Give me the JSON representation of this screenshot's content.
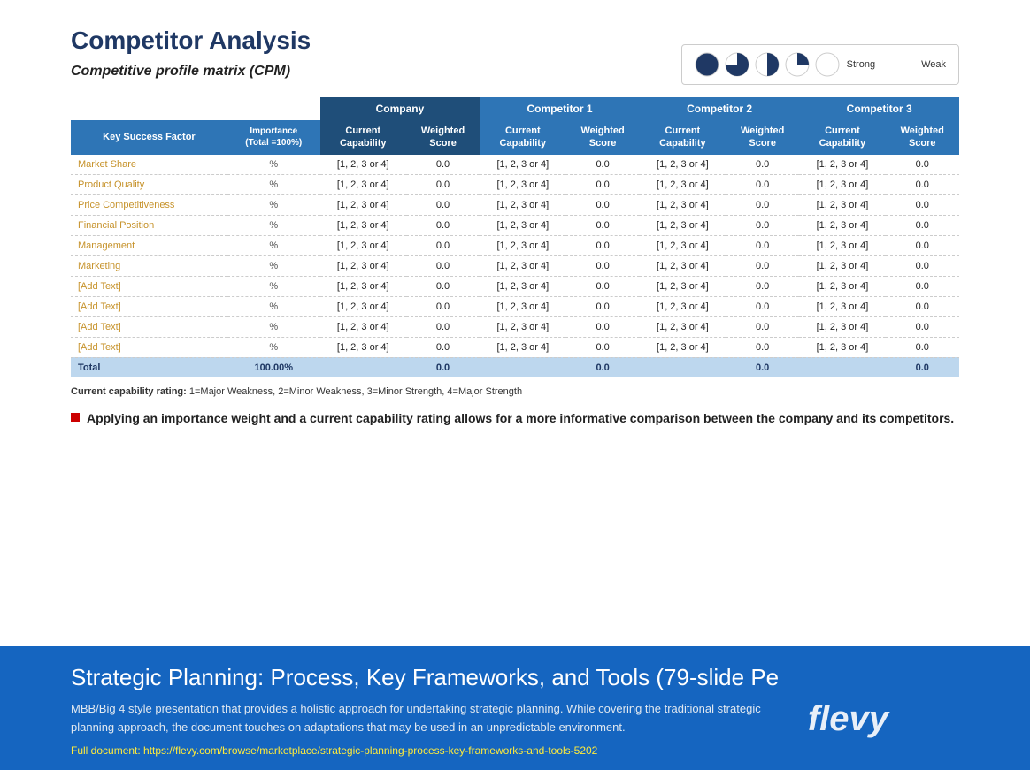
{
  "header": {
    "title": "Competitor Analysis",
    "subtitle": "Competitive profile matrix (CPM)"
  },
  "legend": {
    "label_strong": "Strong",
    "label_weak": "Weak",
    "circles": [
      {
        "fill": "#1f3864",
        "label": "full"
      },
      {
        "fill": "#1f3864",
        "label": "three-quarter",
        "half": true
      },
      {
        "fill": "#1f3864",
        "label": "half"
      },
      {
        "fill": "#1f3864",
        "label": "quarter"
      },
      {
        "fill": "#fff",
        "label": "empty"
      }
    ]
  },
  "table": {
    "groups": {
      "company": "Company",
      "comp1": "Competitor 1",
      "comp2": "Competitor 2",
      "comp3": "Competitor 3"
    },
    "col_headers": {
      "ksf": "Key Success Factor",
      "importance": "Importance (Total =100%)",
      "current_cap": "Current Capability",
      "weighted_score": "Weighted Score"
    },
    "rows": [
      {
        "factor": "Market Share",
        "importance": "%",
        "cap_co": "[1, 2, 3 or 4]",
        "ws_co": "0.0",
        "cap_c1": "[1, 2, 3 or 4]",
        "ws_c1": "0.0",
        "cap_c2": "[1, 2, 3 or 4]",
        "ws_c2": "0.0",
        "cap_c3": "[1, 2, 3 or 4]",
        "ws_c3": "0.0"
      },
      {
        "factor": "Product Quality",
        "importance": "%",
        "cap_co": "[1, 2, 3 or 4]",
        "ws_co": "0.0",
        "cap_c1": "[1, 2, 3 or 4]",
        "ws_c1": "0.0",
        "cap_c2": "[1, 2, 3 or 4]",
        "ws_c2": "0.0",
        "cap_c3": "[1, 2, 3 or 4]",
        "ws_c3": "0.0"
      },
      {
        "factor": "Price Competitiveness",
        "importance": "%",
        "cap_co": "[1, 2, 3 or 4]",
        "ws_co": "0.0",
        "cap_c1": "[1, 2, 3 or 4]",
        "ws_c1": "0.0",
        "cap_c2": "[1, 2, 3 or 4]",
        "ws_c2": "0.0",
        "cap_c3": "[1, 2, 3 or 4]",
        "ws_c3": "0.0"
      },
      {
        "factor": "Financial Position",
        "importance": "%",
        "cap_co": "[1, 2, 3 or 4]",
        "ws_co": "0.0",
        "cap_c1": "[1, 2, 3 or 4]",
        "ws_c1": "0.0",
        "cap_c2": "[1, 2, 3 or 4]",
        "ws_c2": "0.0",
        "cap_c3": "[1, 2, 3 or 4]",
        "ws_c3": "0.0"
      },
      {
        "factor": "Management",
        "importance": "%",
        "cap_co": "[1, 2, 3 or 4]",
        "ws_co": "0.0",
        "cap_c1": "[1, 2, 3 or 4]",
        "ws_c1": "0.0",
        "cap_c2": "[1, 2, 3 or 4]",
        "ws_c2": "0.0",
        "cap_c3": "[1, 2, 3 or 4]",
        "ws_c3": "0.0"
      },
      {
        "factor": "Marketing",
        "importance": "%",
        "cap_co": "[1, 2, 3 or 4]",
        "ws_co": "0.0",
        "cap_c1": "[1, 2, 3 or 4]",
        "ws_c1": "0.0",
        "cap_c2": "[1, 2, 3 or 4]",
        "ws_c2": "0.0",
        "cap_c3": "[1, 2, 3 or 4]",
        "ws_c3": "0.0"
      },
      {
        "factor": "[Add Text]",
        "importance": "%",
        "cap_co": "[1, 2, 3 or 4]",
        "ws_co": "0.0",
        "cap_c1": "[1, 2, 3 or 4]",
        "ws_c1": "0.0",
        "cap_c2": "[1, 2, 3 or 4]",
        "ws_c2": "0.0",
        "cap_c3": "[1, 2, 3 or 4]",
        "ws_c3": "0.0"
      },
      {
        "factor": "[Add Text]",
        "importance": "%",
        "cap_co": "[1, 2, 3 or 4]",
        "ws_co": "0.0",
        "cap_c1": "[1, 2, 3 or 4]",
        "ws_c1": "0.0",
        "cap_c2": "[1, 2, 3 or 4]",
        "ws_c2": "0.0",
        "cap_c3": "[1, 2, 3 or 4]",
        "ws_c3": "0.0"
      },
      {
        "factor": "[Add Text]",
        "importance": "%",
        "cap_co": "[1, 2, 3 or 4]",
        "ws_co": "0.0",
        "cap_c1": "[1, 2, 3 or 4]",
        "ws_c1": "0.0",
        "cap_c2": "[1, 2, 3 or 4]",
        "ws_c2": "0.0",
        "cap_c3": "[1, 2, 3 or 4]",
        "ws_c3": "0.0"
      },
      {
        "factor": "[Add Text]",
        "importance": "%",
        "cap_co": "[1, 2, 3 or 4]",
        "ws_co": "0.0",
        "cap_c1": "[1, 2, 3 or 4]",
        "ws_c1": "0.0",
        "cap_c2": "[1, 2, 3 or 4]",
        "ws_c2": "0.0",
        "cap_c3": "[1, 2, 3 or 4]",
        "ws_c3": "0.0"
      }
    ],
    "total": {
      "label": "Total",
      "importance": "100.00%",
      "ws_co": "0.0",
      "ws_c1": "0.0",
      "ws_c2": "0.0",
      "ws_c3": "0.0"
    }
  },
  "rating_note": {
    "prefix": "Current capability rating:",
    "items": "1=Major Weakness, 2=Minor Weakness, 3=Minor Strength, 4=Major Strength"
  },
  "bullet": {
    "text": "Applying an importance weight and a current capability rating allows for a more informative comparison between the company and its competitors."
  },
  "bottom_bar": {
    "title": "Strategic Planning: Process, Key Frameworks, and Tools",
    "slide_count": "(79-slide Pe",
    "description": "MBB/Big 4 style presentation that  provides a holistic approach for undertaking strategic planning. While covering the traditional strategic planning approach, the document touches on adaptations that may be used in an unpredictable environment.",
    "link_label": "Full document: https://flevy.com/browse/marketplace/strategic-planning-process-key-frameworks-and-tools-5202",
    "logo": "flevy"
  }
}
